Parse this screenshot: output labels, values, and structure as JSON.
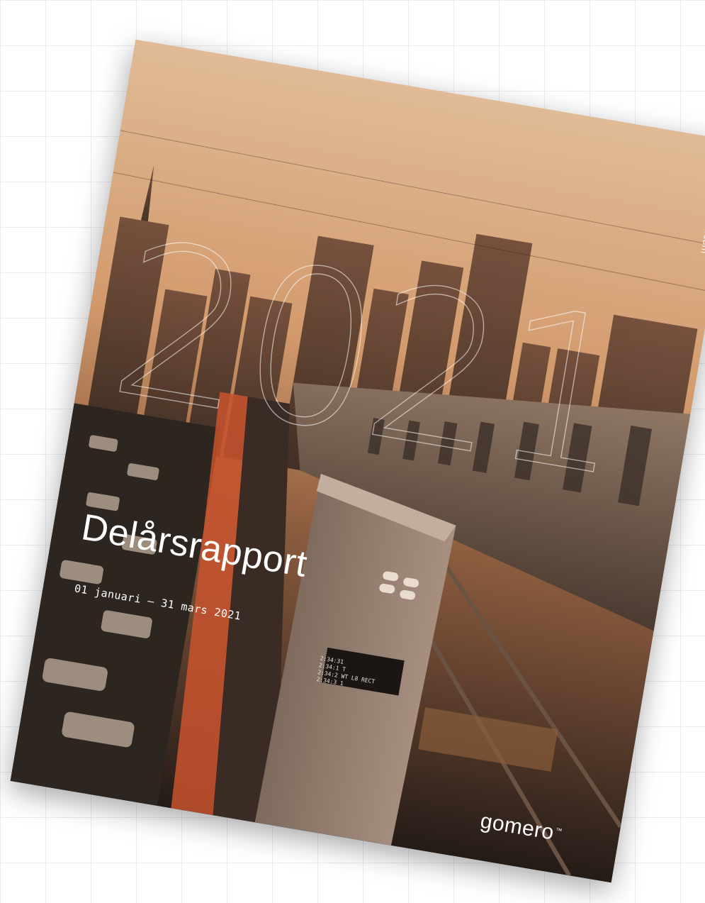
{
  "cover": {
    "year": "2021",
    "url": "www.gomero.com",
    "title": "Delårsrapport",
    "period": "01 januari – 31 mars 2021",
    "brand": "gomero",
    "trademark": "™",
    "display_lines": [
      "2:34:31",
      "2:34:1 T",
      "2:34:2 WT L8 RECT",
      "2:34:3 1"
    ]
  },
  "colors": {
    "sky_top": "#d9b08a",
    "sky_mid": "#c88d62",
    "shadow": "#1f1916",
    "text": "#ffffff"
  }
}
